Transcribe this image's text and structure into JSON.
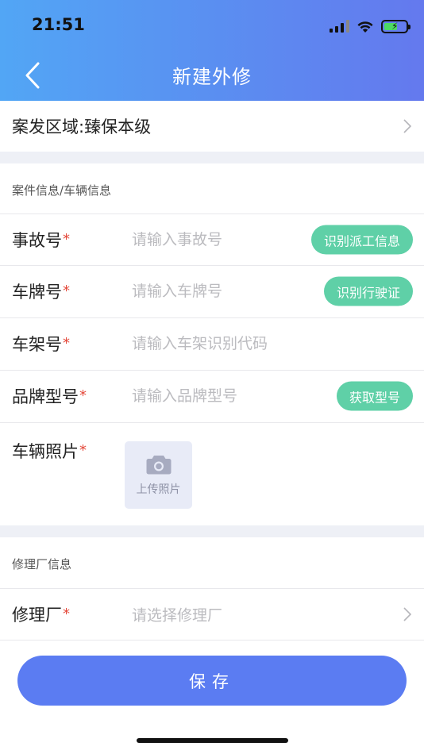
{
  "status_bar": {
    "time": "21:51"
  },
  "nav": {
    "title": "新建外修"
  },
  "region": {
    "label": "案发区域:臻保本级"
  },
  "section_case": {
    "title": "案件信息/车辆信息"
  },
  "fields": {
    "accident_no": {
      "label": "事故号",
      "required": "*",
      "placeholder": "请输入事故号",
      "action": "识别派工信息"
    },
    "plate_no": {
      "label": "车牌号",
      "required": "*",
      "placeholder": "请输入车牌号",
      "action": "识别行驶证"
    },
    "vin": {
      "label": "车架号",
      "required": "*",
      "placeholder": "请输入车架识别代码"
    },
    "brand_model": {
      "label": "品牌型号",
      "required": "*",
      "placeholder": "请输入品牌型号",
      "action": "获取型号"
    },
    "vehicle_photo": {
      "label": "车辆照片",
      "required": "*",
      "upload_text": "上传照片"
    }
  },
  "section_repair": {
    "title": "修理厂信息"
  },
  "repair_shop": {
    "label": "修理厂",
    "required": "*",
    "placeholder": "请选择修理厂"
  },
  "save": {
    "label": "保存"
  },
  "colors": {
    "accent": "#5b7cf2",
    "action_pill": "#5fd0a7",
    "required": "#e4483a",
    "header_start": "#52a6f5",
    "header_end": "#6479ee"
  }
}
